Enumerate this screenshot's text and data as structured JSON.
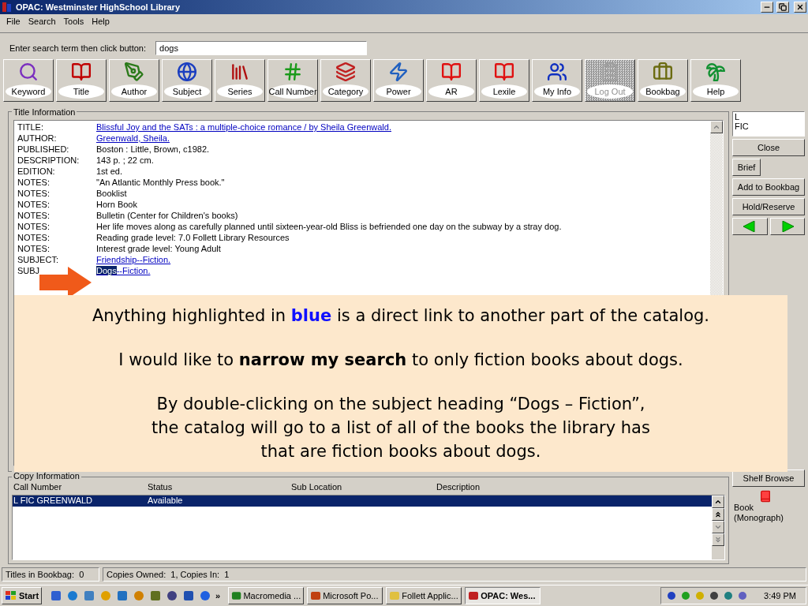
{
  "window": {
    "title": "OPAC: Westminster HighSchool Library"
  },
  "menu": [
    "File",
    "Search",
    "Tools",
    "Help"
  ],
  "search": {
    "label": "Enter search term then click button:",
    "value": "dogs"
  },
  "toolbar": [
    {
      "label": "Keyword",
      "disabled": false
    },
    {
      "label": "Title",
      "disabled": false
    },
    {
      "label": "Author",
      "disabled": false
    },
    {
      "label": "Subject",
      "disabled": false
    },
    {
      "label": "Series",
      "disabled": false
    },
    {
      "label": "Call Number",
      "disabled": false
    },
    {
      "label": "Category",
      "disabled": false
    },
    {
      "label": "Power",
      "disabled": false
    },
    {
      "label": "AR",
      "disabled": false
    },
    {
      "label": "Lexile",
      "disabled": false
    },
    {
      "label": "My Info",
      "disabled": false
    },
    {
      "label": "Log Out",
      "disabled": true
    },
    {
      "label": "Bookbag",
      "disabled": false
    },
    {
      "label": "Help",
      "disabled": false
    }
  ],
  "title_information": {
    "legend": "Title Information",
    "rows": [
      {
        "label": "TITLE:",
        "kind": "link",
        "parts": [
          {
            "text": "Blissful Joy and the SATs : a multiple-choice romance / by Sheila Greenwald.",
            "selected": false
          }
        ]
      },
      {
        "label": "AUTHOR:",
        "kind": "link",
        "parts": [
          {
            "text": "Greenwald, Sheila.",
            "selected": false
          }
        ]
      },
      {
        "label": "PUBLISHED:",
        "kind": "text",
        "parts": [
          {
            "text": "Boston : Little, Brown, c1982.",
            "selected": false
          }
        ]
      },
      {
        "label": "DESCRIPTION:",
        "kind": "text",
        "parts": [
          {
            "text": "143 p. ; 22 cm.",
            "selected": false
          }
        ]
      },
      {
        "label": "EDITION:",
        "kind": "text",
        "parts": [
          {
            "text": "1st ed.",
            "selected": false
          }
        ]
      },
      {
        "label": "NOTES:",
        "kind": "text",
        "parts": [
          {
            "text": "\"An Atlantic Monthly Press book.\"",
            "selected": false
          }
        ]
      },
      {
        "label": "NOTES:",
        "kind": "text",
        "parts": [
          {
            "text": "Booklist",
            "selected": false
          }
        ]
      },
      {
        "label": "NOTES:",
        "kind": "text",
        "parts": [
          {
            "text": "Horn Book",
            "selected": false
          }
        ]
      },
      {
        "label": "NOTES:",
        "kind": "text",
        "parts": [
          {
            "text": "Bulletin (Center for Children's books)",
            "selected": false
          }
        ]
      },
      {
        "label": "NOTES:",
        "kind": "text",
        "parts": [
          {
            "text": "Her life moves along as carefully planned until sixteen-year-old Bliss is befriended one day on the subway by a stray dog.",
            "selected": false
          }
        ]
      },
      {
        "label": "NOTES:",
        "kind": "text",
        "parts": [
          {
            "text": "Reading grade level: 7.0 Follett Library Resources",
            "selected": false
          }
        ]
      },
      {
        "label": "NOTES:",
        "kind": "text",
        "parts": [
          {
            "text": "Interest grade level: Young Adult",
            "selected": false
          }
        ]
      },
      {
        "label": "SUBJECT:",
        "kind": "link",
        "parts": [
          {
            "text": "Friendship--Fiction.",
            "selected": false
          }
        ]
      },
      {
        "label": "SUBJ",
        "kind": "link",
        "parts": [
          {
            "text": "Dogs",
            "selected": true
          },
          {
            "text": "--Fiction.",
            "selected": false
          }
        ]
      }
    ]
  },
  "side_panel": {
    "call_number_lines": [
      "L",
      "FIC"
    ],
    "buttons": [
      "Close",
      "Brief",
      "Add to Bookbag",
      "Hold/Reserve"
    ],
    "shelf_browse": "Shelf Browse",
    "material_lines": [
      "Book",
      "(Monograph)"
    ]
  },
  "copy_information": {
    "legend": "Copy Information",
    "columns": [
      "Call Number",
      "Status",
      "Sub Location",
      "Description"
    ],
    "rows": [
      {
        "cells": [
          "L FIC GREENWALD",
          "Available"
        ],
        "selected": true
      }
    ]
  },
  "callout": {
    "paragraphs": [
      {
        "lines": [
          "Anything highlighted in **blue** is a direct link to another part of the catalog."
        ],
        "kind": "link-note"
      },
      {
        "lines": [
          "I would like to **narrow my search** to only fiction books about dogs."
        ],
        "kind": "plain"
      },
      {
        "lines": [
          "By double-clicking on the subject heading “Dogs – Fiction”,",
          "the catalog will go to a list of all of the books the library has",
          "that are fiction books about dogs."
        ],
        "kind": "plain"
      }
    ]
  },
  "status_bar": [
    "Titles in Bookbag:  0",
    "Copies Owned:  1, Copies In:  1"
  ],
  "taskbar": {
    "start": "Start",
    "overflow": "»",
    "tasks": [
      {
        "label": "Macromedia ...",
        "selected": false
      },
      {
        "label": "Microsoft Po...",
        "selected": false
      },
      {
        "label": "Follett Applic...",
        "selected": false
      },
      {
        "label": "OPAC: Wes...",
        "selected": true
      }
    ],
    "clock": "3:49 PM"
  }
}
